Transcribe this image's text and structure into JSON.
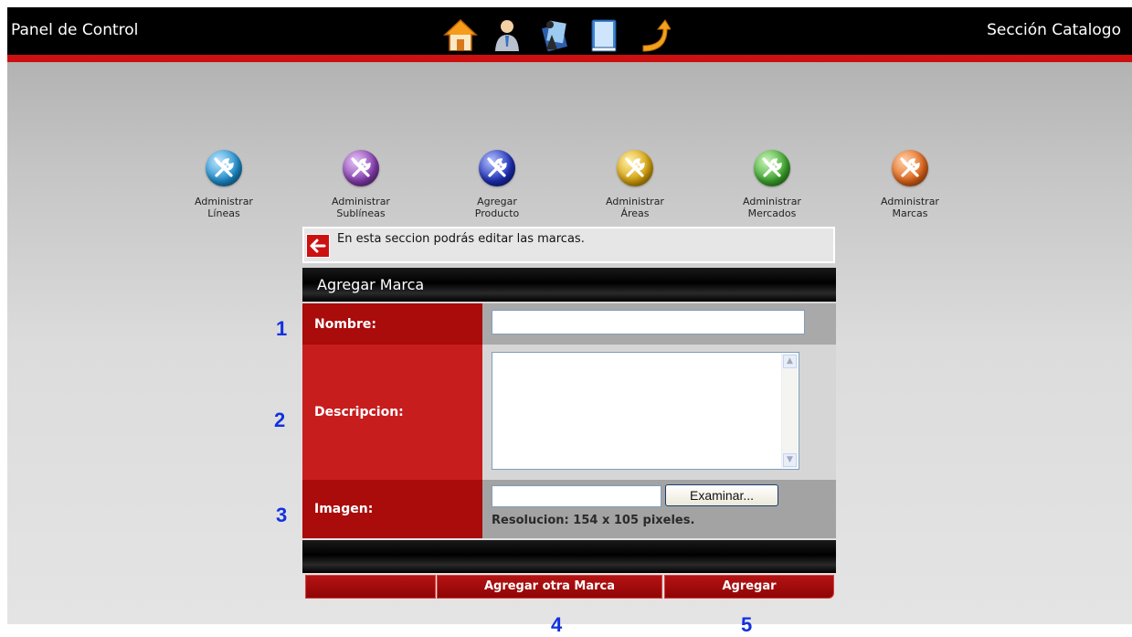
{
  "header": {
    "app_title": "Panel de Control",
    "section_title": "Sección Catalogo",
    "toolbar_icons": [
      "home-icon",
      "user-icon",
      "catalog-icon",
      "book-icon",
      "exit-icon"
    ]
  },
  "admin_menu": [
    {
      "label": "Administrar\nLíneas",
      "icon": "wrench-icon",
      "color": "#1f8fcf"
    },
    {
      "label": "Administrar\nSublíneas",
      "icon": "wrench-icon",
      "color": "#8a3fb3"
    },
    {
      "label": "Agregar\nProducto",
      "icon": "wrench-icon",
      "color": "#1d2fb8"
    },
    {
      "label": "Administrar\nÁreas",
      "icon": "wrench-icon",
      "color": "#d9a40c"
    },
    {
      "label": "Administrar\nMercados",
      "icon": "wrench-icon",
      "color": "#3faa2e"
    },
    {
      "label": "Administrar\nMarcas",
      "icon": "wrench-icon",
      "color": "#e4681c"
    }
  ],
  "info": {
    "text": "En esta seccion podrás editar las marcas.",
    "back_icon": "back-arrow-icon"
  },
  "form": {
    "title": "Agregar Marca",
    "nombre_label": "Nombre:",
    "nombre_value": "",
    "descripcion_label": "Descripcion:",
    "descripcion_value": "",
    "imagen_label": "Imagen:",
    "imagen_value": "",
    "browse_label": "Examinar...",
    "resolution_text": "Resolucion: 154 x 105 pixeles."
  },
  "actions": {
    "blank_label": "",
    "add_other_label": "Agregar otra Marca",
    "add_label": "Agregar"
  },
  "markers": [
    "1",
    "2",
    "3",
    "4",
    "5"
  ],
  "colors": {
    "accent_red": "#aa0b0b",
    "top_bar": "#000000",
    "marker_blue": "#1131e0"
  }
}
